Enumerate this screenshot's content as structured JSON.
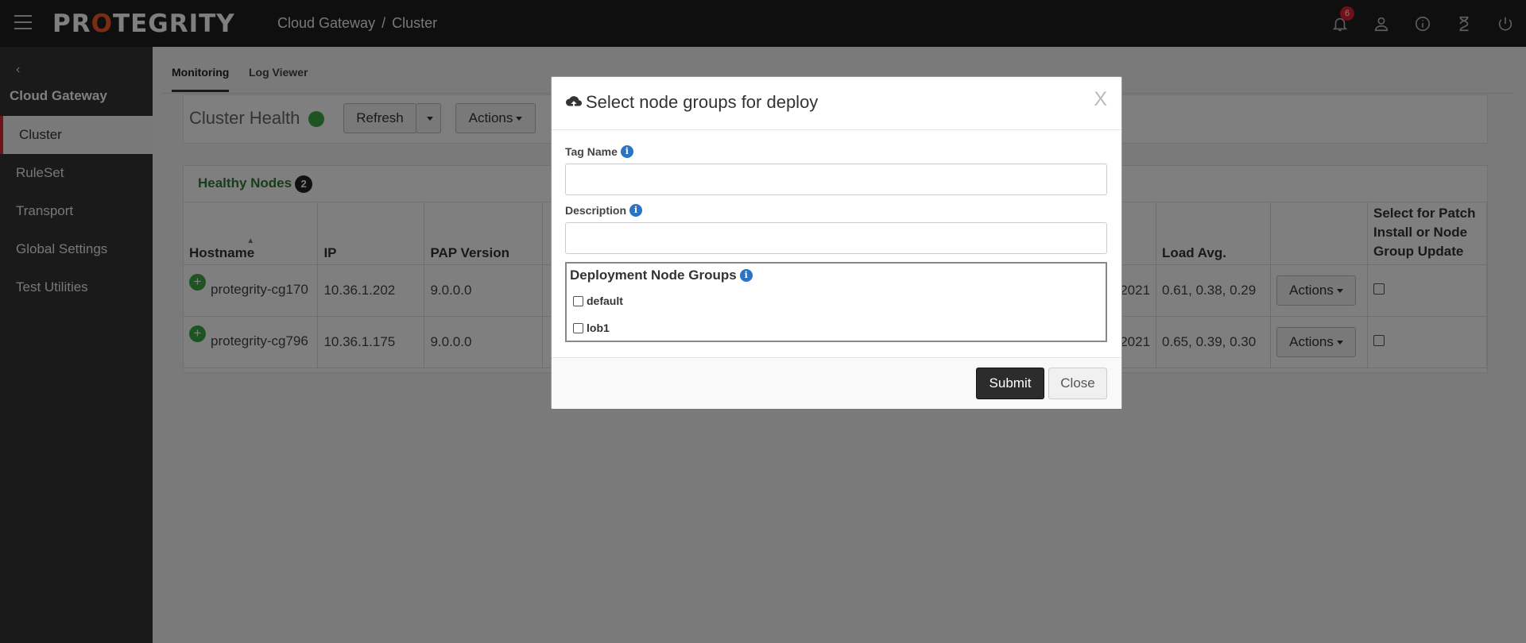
{
  "header": {
    "logo": "PROTEGRITY",
    "breadcrumb": [
      "Cloud Gateway",
      "Cluster"
    ],
    "notification_count": "6",
    "icons": [
      "bell-icon",
      "user-icon",
      "info-icon",
      "hourglass-icon",
      "power-icon"
    ]
  },
  "sidebar": {
    "title": "Cloud Gateway",
    "items": [
      "Cluster",
      "RuleSet",
      "Transport",
      "Global Settings",
      "Test Utilities"
    ],
    "active": "Cluster"
  },
  "tabs": [
    "Monitoring",
    "Log Viewer"
  ],
  "cluster_health": {
    "title": "Cluster Health",
    "refresh_label": "Refresh",
    "actions_label": "Actions"
  },
  "nodes": {
    "title": "Healthy Nodes",
    "count": "2",
    "columns": [
      "Hostname",
      "IP",
      "PAP Version",
      "Load Avg.",
      "Select for Patch Install or Node Group Update"
    ],
    "rows": [
      {
        "hostname": "protegrity-cg170",
        "ip": "10.36.1.202",
        "version": "9.0.0.0",
        "date_fragment": "2021",
        "load": "0.61, 0.38, 0.29",
        "action": "Actions"
      },
      {
        "hostname": "protegrity-cg796",
        "ip": "10.36.1.175",
        "version": "9.0.0.0",
        "date_fragment": "2021",
        "load": "0.65, 0.39, 0.30",
        "action": "Actions"
      }
    ]
  },
  "modal": {
    "title": "Select node groups for deploy",
    "close": "X",
    "tag_label": "Tag Name",
    "tag_value": "",
    "desc_label": "Description",
    "desc_value": "",
    "groups_label": "Deployment Node Groups",
    "groups": [
      "default",
      "lob1"
    ],
    "submit": "Submit",
    "close_button": "Close"
  }
}
